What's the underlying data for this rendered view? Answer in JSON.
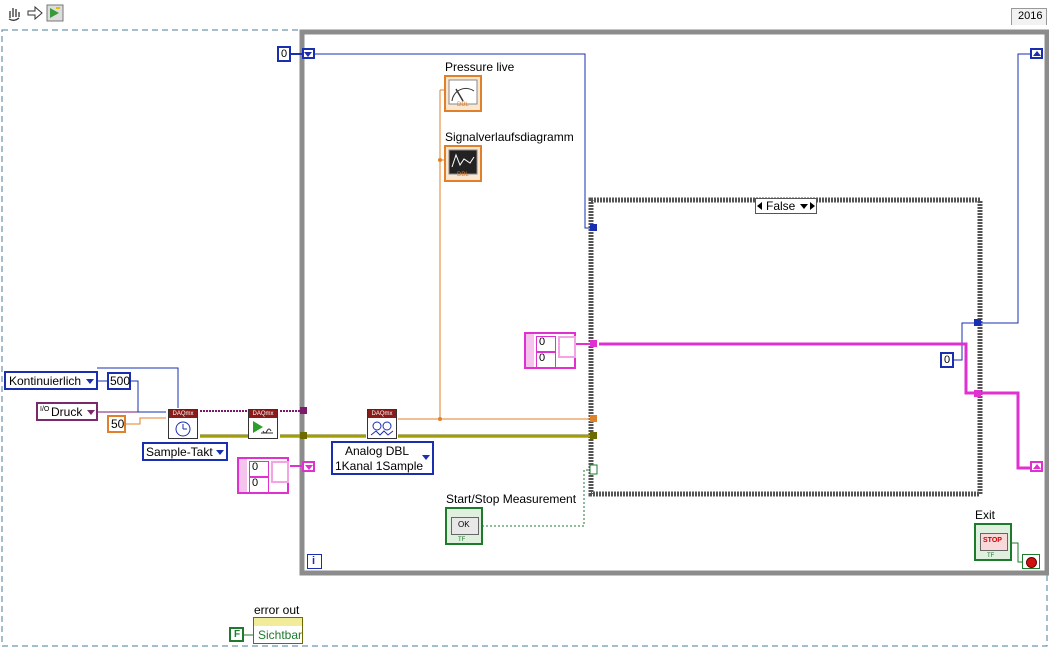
{
  "toolbar": {
    "version_label": "2016",
    "icons": [
      "hand-icon",
      "arrow-right-icon",
      "run-arrow-icon"
    ]
  },
  "while_loop": {
    "iteration_terminal": "i",
    "shift_register_init": "0"
  },
  "indicators": {
    "pressure_live": {
      "label": "Pressure live",
      "type": "DBL"
    },
    "waveform_chart": {
      "label": "Signalverlaufsdiagramm",
      "type": "DBL"
    }
  },
  "case_structure": {
    "selector_value": "False",
    "constant": "0"
  },
  "controls": {
    "sample_mode": "Kontinuierlich",
    "samples": "500",
    "rate": "50",
    "channel": "Druck",
    "channel_prefix": "I/O",
    "timing_polymorph": "Sample-Takt",
    "read_polymorph_line1": "Analog DBL",
    "read_polymorph_line2": "1Kanal 1Sample",
    "array_left": [
      "0",
      "0"
    ],
    "array_case": [
      "0",
      "0"
    ],
    "start_stop": {
      "label": "Start/Stop Measurement",
      "button": "OK",
      "type": "TF"
    },
    "exit": {
      "label": "Exit",
      "button": "STOP",
      "type": "TF"
    }
  },
  "error_out": {
    "label": "error out",
    "bool_constant": "F",
    "value": "Sichtbar"
  },
  "daq_nodes": [
    "DAQmx",
    "DAQmx",
    "DAQmx"
  ],
  "colors": {
    "error_wire": "#b8a800",
    "task_wire": "#7a1a6a",
    "dbl_wire": "#e0802a",
    "int_wire": "#1a2fb0",
    "array_wire": "#e030d0",
    "bool_wire": "#1e7a2e",
    "loop_frame": "#808080"
  }
}
